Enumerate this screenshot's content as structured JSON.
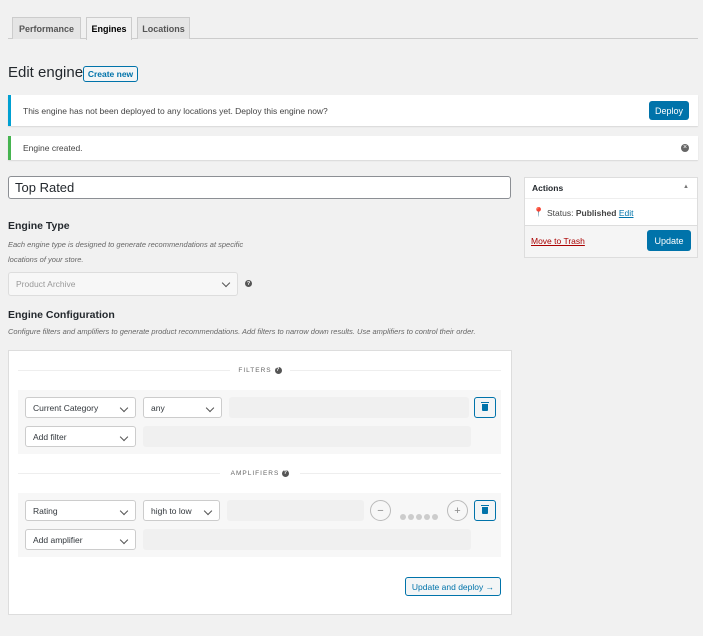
{
  "tabs": [
    {
      "label": "Performance"
    },
    {
      "label": "Engines",
      "active": true
    },
    {
      "label": "Locations"
    }
  ],
  "header": {
    "title": "Edit engine",
    "create_new": "Create new"
  },
  "notices": {
    "deploy_text": "This engine has not been deployed to any locations yet. Deploy this engine now?",
    "deploy_button": "Deploy",
    "created_text": "Engine created.",
    "info_color": "#00a0d2",
    "success_color": "#46b450"
  },
  "engine": {
    "title_value": "Top Rated",
    "type_heading": "Engine Type",
    "type_desc": "Each engine type is designed to generate recommendations at specific locations of your store.",
    "type_select": "Product Archive",
    "config_heading": "Engine Configuration",
    "config_desc": "Configure filters and amplifiers to generate product recommendations. Add filters to narrow down results. Use amplifiers to control their order."
  },
  "filters": {
    "label": "FILTERS",
    "row1": {
      "field": "Current Category",
      "op": "any"
    },
    "add": "Add filter"
  },
  "amplifiers": {
    "label": "AMPLIFIERS",
    "row1": {
      "field": "Rating",
      "order": "high to low",
      "weight": 0
    },
    "add": "Add amplifier"
  },
  "update_deploy": "Update and deploy →",
  "actions": {
    "title": "Actions",
    "status_label": "Status:",
    "status_value": "Published",
    "edit": "Edit",
    "trash": "Move to Trash",
    "update": "Update"
  },
  "colors": {
    "primary": "#0073aa",
    "danger": "#a00"
  }
}
